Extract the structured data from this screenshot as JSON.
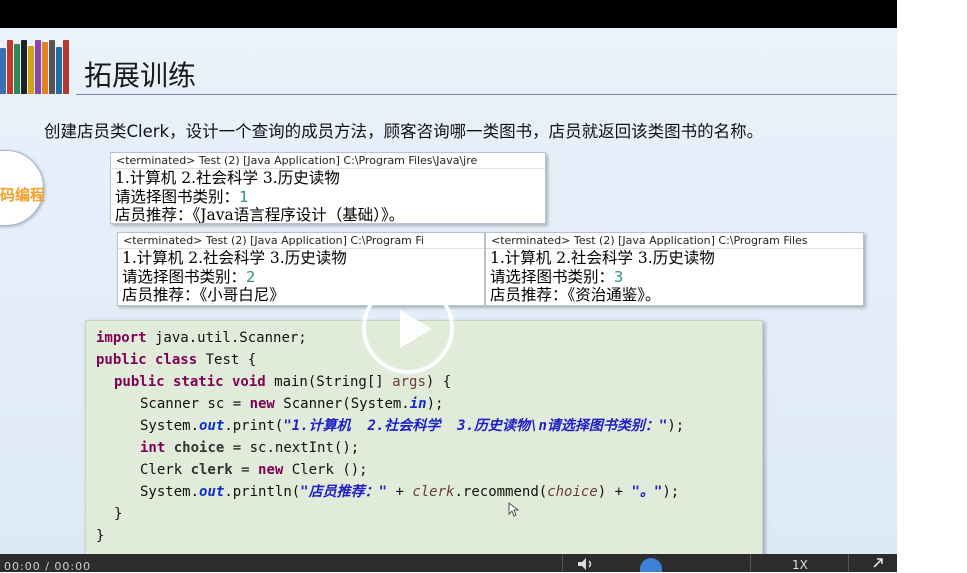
{
  "slide": {
    "title": "拓展训练",
    "instruction": "创建店员类Clerk，设计一个查询的成员方法，顾客咨询哪一类图书，店员就返回该类图书的名称。",
    "badge": "码编程"
  },
  "consoles": [
    {
      "header": "<terminated> Test (2) [Java Application] C:\\Program Files\\Java\\jre",
      "menu": "1.计算机  2.社会科学  3.历史读物",
      "prompt": "请选择图书类别：",
      "choice": "1",
      "result": "店员推荐：《Java语言程序设计（基础）》。"
    },
    {
      "header": "<terminated> Test (2) [Java Application] C:\\Program Fi",
      "menu": "1.计算机  2.社会科学  3.历史读物",
      "prompt": "请选择图书类别：",
      "choice": "2",
      "result": "店员推荐：《小哥白尼》"
    },
    {
      "header": "<terminated> Test (2) [Java Application] C:\\Program Files",
      "menu": "1.计算机  2.社会科学  3.历史读物",
      "prompt": "请选择图书类别：",
      "choice": "3",
      "result": "店员推荐：《资治通鉴》。"
    }
  ],
  "code": {
    "l1a": "import",
    "l1b": " java.util.Scanner;",
    "l2a": "public class",
    "l2b": " Test {",
    "l3a": "public static void",
    "l3b": " main(String[] ",
    "l3c": "args",
    "l3d": ") {",
    "l4a": "Scanner sc = ",
    "l4b": "new",
    "l4c": " Scanner(System.",
    "l4d": "in",
    "l4e": ");",
    "l5a": "System.",
    "l5b": "out",
    "l5c": ".print(",
    "l5d": "\"1.计算机  2.社会科学  3.历史读物\\n请选择图书类别：\"",
    "l5e": ");",
    "l6a": "int",
    "l6b": " choice",
    "l6c": " = sc.nextInt();",
    "l7a": "Clerk ",
    "l7b": "clerk",
    "l7c": " = ",
    "l7d": "new",
    "l7e": " Clerk ();",
    "l8a": "System.",
    "l8b": "out",
    "l8c": ".println(",
    "l8d": "\"店员推荐：\"",
    "l8e": " + ",
    "l8f": "clerk",
    "l8g": ".recommend(",
    "l8h": "choice",
    "l8i": ") + ",
    "l8j": "\"。\"",
    "l8k": ");",
    "l9": "}",
    "l10": "}"
  },
  "player": {
    "time": "00:00 / 00:00",
    "speed": "1X"
  },
  "colors": {
    "keyword": "#7f0055",
    "string": "#1f1fc8",
    "field": "#0c2ec8",
    "console_number": "#2f9a69",
    "code_bg": "#e1ebd9"
  }
}
